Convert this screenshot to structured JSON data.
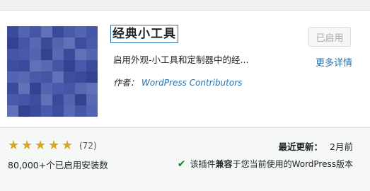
{
  "plugin": {
    "title": "经典小工具",
    "description": "启用外观-小工具和定制器中的经...",
    "author_label": "作者：",
    "author_name": "WordPress Contributors",
    "activated_button": "已启用",
    "more_details": "更多详情",
    "thumbnail_icon": "pixel-mosaic-icon",
    "thumbnail_colors": [
      "#3b4b9c",
      "#4556a6",
      "#5364b0",
      "#6270b8",
      "#34438f",
      "#4a5aaa",
      "#5869b4",
      "#3e4e9f"
    ]
  },
  "footer": {
    "stars": [
      "★",
      "★",
      "★",
      "★",
      "★"
    ],
    "star_color": "#dba617",
    "rating_count": "(72)",
    "active_installs": "80,000+个已启用安装数",
    "last_updated_label": "最近更新：",
    "last_updated_value": "2月前",
    "compat_check": "✔",
    "compat_prefix": "该插件",
    "compat_bold": "兼容",
    "compat_suffix": "于您当前使用的WordPress版本",
    "check_color": "#008a20"
  }
}
